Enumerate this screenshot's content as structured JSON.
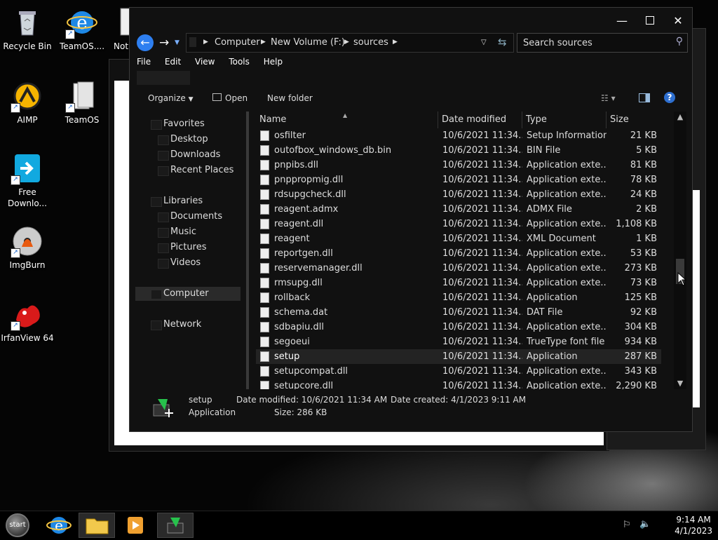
{
  "desktop": {
    "icons": [
      {
        "label": "Recycle Bin"
      },
      {
        "label": "TeamOS...."
      },
      {
        "label": "Not"
      },
      {
        "label": "AIMP"
      },
      {
        "label": "TeamOS"
      },
      {
        "label": "Free Downlo..."
      },
      {
        "label": "ImgBurn"
      },
      {
        "label": "IrfanView 64"
      }
    ]
  },
  "explorer": {
    "breadcrumb": [
      "Computer",
      "New Volume (F:)",
      "sources"
    ],
    "search_placeholder": "Search sources",
    "menu": [
      "File",
      "Edit",
      "View",
      "Tools",
      "Help"
    ],
    "toolbar": {
      "organize": "Organize",
      "open": "Open",
      "new_folder": "New folder"
    },
    "nav": {
      "favorites": "Favorites",
      "desktop": "Desktop",
      "downloads": "Downloads",
      "recent": "Recent Places",
      "libraries": "Libraries",
      "documents": "Documents",
      "music": "Music",
      "pictures": "Pictures",
      "videos": "Videos",
      "computer": "Computer",
      "network": "Network"
    },
    "columns": {
      "name": "Name",
      "date": "Date modified",
      "type": "Type",
      "size": "Size"
    },
    "files": [
      {
        "name": "osfilter",
        "date": "10/6/2021 11:34...",
        "type": "Setup Information",
        "size": "21 KB"
      },
      {
        "name": "outofbox_windows_db.bin",
        "date": "10/6/2021 11:34...",
        "type": "BIN File",
        "size": "5 KB"
      },
      {
        "name": "pnpibs.dll",
        "date": "10/6/2021 11:34...",
        "type": "Application exte...",
        "size": "81 KB"
      },
      {
        "name": "pnppropmig.dll",
        "date": "10/6/2021 11:34...",
        "type": "Application exte...",
        "size": "78 KB"
      },
      {
        "name": "rdsupgcheck.dll",
        "date": "10/6/2021 11:34...",
        "type": "Application exte...",
        "size": "24 KB"
      },
      {
        "name": "reagent.admx",
        "date": "10/6/2021 11:34...",
        "type": "ADMX File",
        "size": "2 KB"
      },
      {
        "name": "reagent.dll",
        "date": "10/6/2021 11:34...",
        "type": "Application exte...",
        "size": "1,108 KB"
      },
      {
        "name": "reagent",
        "date": "10/6/2021 11:34...",
        "type": "XML Document",
        "size": "1 KB"
      },
      {
        "name": "reportgen.dll",
        "date": "10/6/2021 11:34...",
        "type": "Application exte...",
        "size": "53 KB"
      },
      {
        "name": "reservemanager.dll",
        "date": "10/6/2021 11:34...",
        "type": "Application exte...",
        "size": "273 KB"
      },
      {
        "name": "rmsupg.dll",
        "date": "10/6/2021 11:34...",
        "type": "Application exte...",
        "size": "73 KB"
      },
      {
        "name": "rollback",
        "date": "10/6/2021 11:34...",
        "type": "Application",
        "size": "125 KB"
      },
      {
        "name": "schema.dat",
        "date": "10/6/2021 11:34...",
        "type": "DAT File",
        "size": "92 KB"
      },
      {
        "name": "sdbapiu.dll",
        "date": "10/6/2021 11:34...",
        "type": "Application exte...",
        "size": "304 KB"
      },
      {
        "name": "segoeui",
        "date": "10/6/2021 11:34...",
        "type": "TrueType font file",
        "size": "934 KB"
      },
      {
        "name": "setup",
        "date": "10/6/2021 11:34...",
        "type": "Application",
        "size": "287 KB"
      },
      {
        "name": "setupcompat.dll",
        "date": "10/6/2021 11:34...",
        "type": "Application exte...",
        "size": "343 KB"
      },
      {
        "name": "setupcore.dll",
        "date": "10/6/2021 11:34...",
        "type": "Application exte...",
        "size": "2,290 KB"
      }
    ],
    "selected_index": 15,
    "details": {
      "name": "setup",
      "kind": "Application",
      "modified": "Date modified: 10/6/2021 11:34 AM",
      "created": "Date created: 4/1/2023 9:11 AM",
      "size": "Size: 286 KB"
    }
  },
  "taskbar": {
    "start_label": "start",
    "time": "9:14 AM",
    "date": "4/1/2023"
  },
  "colors": {
    "accent": "#2e7ff0",
    "window_bg": "#111111"
  }
}
